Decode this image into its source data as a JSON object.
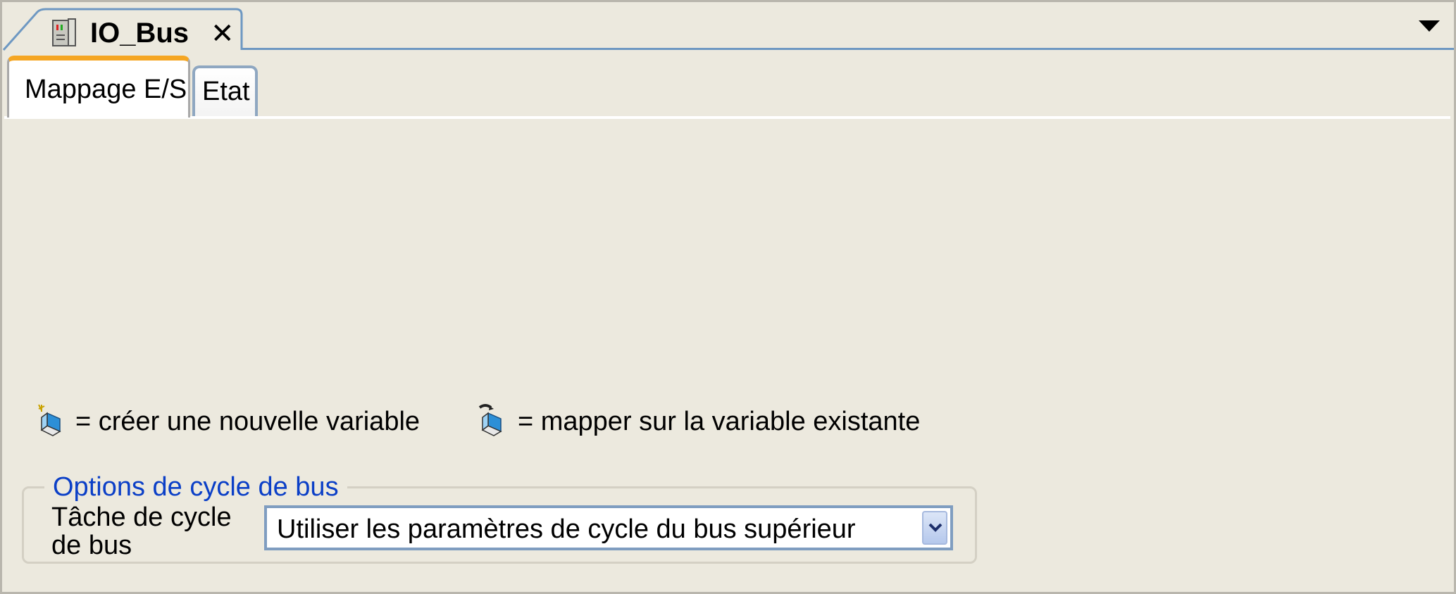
{
  "document_tab": {
    "title": "IO_Bus",
    "close_glyph": "✕",
    "icon": "device-icon"
  },
  "overflow_menu": {
    "icon": "dropdown-arrow-icon"
  },
  "subtabs": [
    {
      "label": "Mappage E/S",
      "active": true
    },
    {
      "label": "Etat",
      "active": false
    }
  ],
  "legend": {
    "create": {
      "icon": "create-variable-icon",
      "text": "= créer une nouvelle variable"
    },
    "map": {
      "icon": "map-variable-icon",
      "text": "= mapper sur la variable existante"
    }
  },
  "bus_cycle_options": {
    "title": "Options de cycle de bus",
    "task_label": "Tâche de cycle de bus",
    "task_value": "Utiliser les paramètres de cycle du bus supérieur",
    "dropdown_icon": "chevron-down-icon"
  },
  "colors": {
    "background": "#ece9de",
    "active_tab_accent": "#f5a623",
    "group_title": "#0b3fc7",
    "tab_border_blue": "#6e98c2"
  }
}
